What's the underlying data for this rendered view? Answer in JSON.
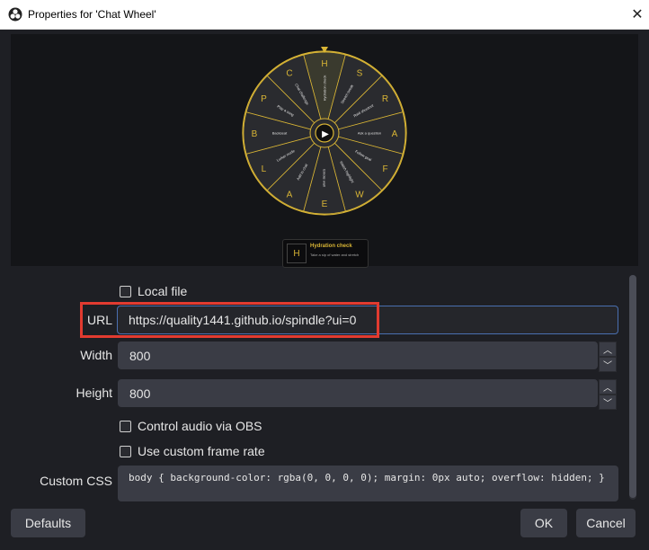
{
  "window": {
    "title": "Properties for 'Chat Wheel'",
    "close_glyph": "✕"
  },
  "preview": {
    "wheel_letters": [
      "H",
      "S",
      "R",
      "A",
      "F",
      "W",
      "E",
      "A",
      "L",
      "B",
      "P",
      "C"
    ],
    "wheel_segment_texts": [
      "Hydration check",
      "Stretch break",
      "Raid shoutout",
      "Ask a question",
      "Follow goal",
      "Watch highlight",
      "Emote wall",
      "Add to chat",
      "Lurker mode",
      "Backseat",
      "Play a song",
      "Chat challenge"
    ],
    "play_glyph": "▶",
    "colors": {
      "gold": "#d9b535",
      "segment": "#2a2b2f",
      "background": "#141518"
    },
    "result_letter": "H",
    "result_title": "Hydration check",
    "result_subtitle": "Take a sip of water and stretch"
  },
  "form": {
    "local_file_label": "Local file",
    "url_label": "URL",
    "url_value": "https://quality1441.github.io/spindle?ui=0",
    "width_label": "Width",
    "width_value": "800",
    "height_label": "Height",
    "height_value": "800",
    "control_audio_label": "Control audio via OBS",
    "custom_fps_label": "Use custom frame rate",
    "custom_css_label": "Custom CSS",
    "custom_css_value": "body { background-color: rgba(0, 0, 0, 0); margin: 0px auto; overflow: hidden; }",
    "spin_up_glyph": "︿",
    "spin_down_glyph": "﹀"
  },
  "buttons": {
    "defaults": "Defaults",
    "ok": "OK",
    "cancel": "Cancel"
  }
}
